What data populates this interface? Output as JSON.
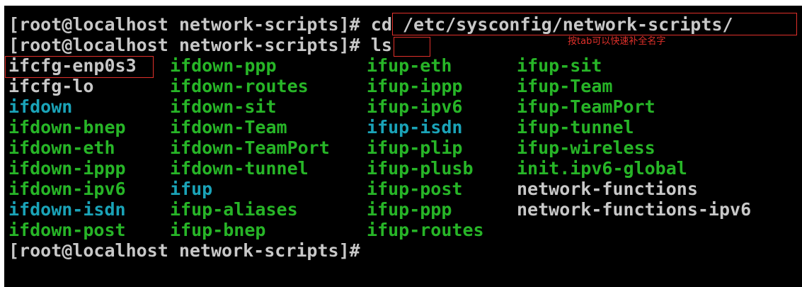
{
  "terminal": {
    "prompt": "[root@localhost network-scripts]#",
    "commands": [
      "cd /etc/sysconfig/network-scripts/",
      "ls"
    ],
    "listing": {
      "col1": [
        {
          "name": "ifcfg-enp0s3",
          "color": "#c8c8c8"
        },
        {
          "name": "ifcfg-lo",
          "color": "#c8c8c8"
        },
        {
          "name": "ifdown",
          "color": "#1aa3b8"
        },
        {
          "name": "ifdown-bnep",
          "color": "#27b527"
        },
        {
          "name": "ifdown-eth",
          "color": "#27b527"
        },
        {
          "name": "ifdown-ippp",
          "color": "#27b527"
        },
        {
          "name": "ifdown-ipv6",
          "color": "#27b527"
        },
        {
          "name": "ifdown-isdn",
          "color": "#1aa3b8"
        },
        {
          "name": "ifdown-post",
          "color": "#27b527"
        }
      ],
      "col2": [
        {
          "name": "ifdown-ppp",
          "color": "#27b527"
        },
        {
          "name": "ifdown-routes",
          "color": "#27b527"
        },
        {
          "name": "ifdown-sit",
          "color": "#27b527"
        },
        {
          "name": "ifdown-Team",
          "color": "#27b527"
        },
        {
          "name": "ifdown-TeamPort",
          "color": "#27b527"
        },
        {
          "name": "ifdown-tunnel",
          "color": "#27b527"
        },
        {
          "name": "ifup",
          "color": "#1aa3b8"
        },
        {
          "name": "ifup-aliases",
          "color": "#27b527"
        },
        {
          "name": "ifup-bnep",
          "color": "#27b527"
        }
      ],
      "col3": [
        {
          "name": "ifup-eth",
          "color": "#27b527"
        },
        {
          "name": "ifup-ippp",
          "color": "#27b527"
        },
        {
          "name": "ifup-ipv6",
          "color": "#27b527"
        },
        {
          "name": "ifup-isdn",
          "color": "#1aa3b8"
        },
        {
          "name": "ifup-plip",
          "color": "#27b527"
        },
        {
          "name": "ifup-plusb",
          "color": "#27b527"
        },
        {
          "name": "ifup-post",
          "color": "#27b527"
        },
        {
          "name": "ifup-ppp",
          "color": "#27b527"
        },
        {
          "name": "ifup-routes",
          "color": "#27b527"
        }
      ],
      "col4": [
        {
          "name": "ifup-sit",
          "color": "#27b527"
        },
        {
          "name": "ifup-Team",
          "color": "#27b527"
        },
        {
          "name": "ifup-TeamPort",
          "color": "#27b527"
        },
        {
          "name": "ifup-tunnel",
          "color": "#27b527"
        },
        {
          "name": "ifup-wireless",
          "color": "#27b527"
        },
        {
          "name": "init.ipv6-global",
          "color": "#27b527"
        },
        {
          "name": "network-functions",
          "color": "#c8c8c8"
        },
        {
          "name": "network-functions-ipv6",
          "color": "#c8c8c8"
        }
      ]
    }
  },
  "annotation": {
    "text": "按tab可以快速补全名字",
    "color": "#e0302a"
  },
  "colors": {
    "background": "#000000",
    "default_text": "#c8c8c8",
    "executable": "#27b527",
    "symlink": "#1aa3b8"
  }
}
